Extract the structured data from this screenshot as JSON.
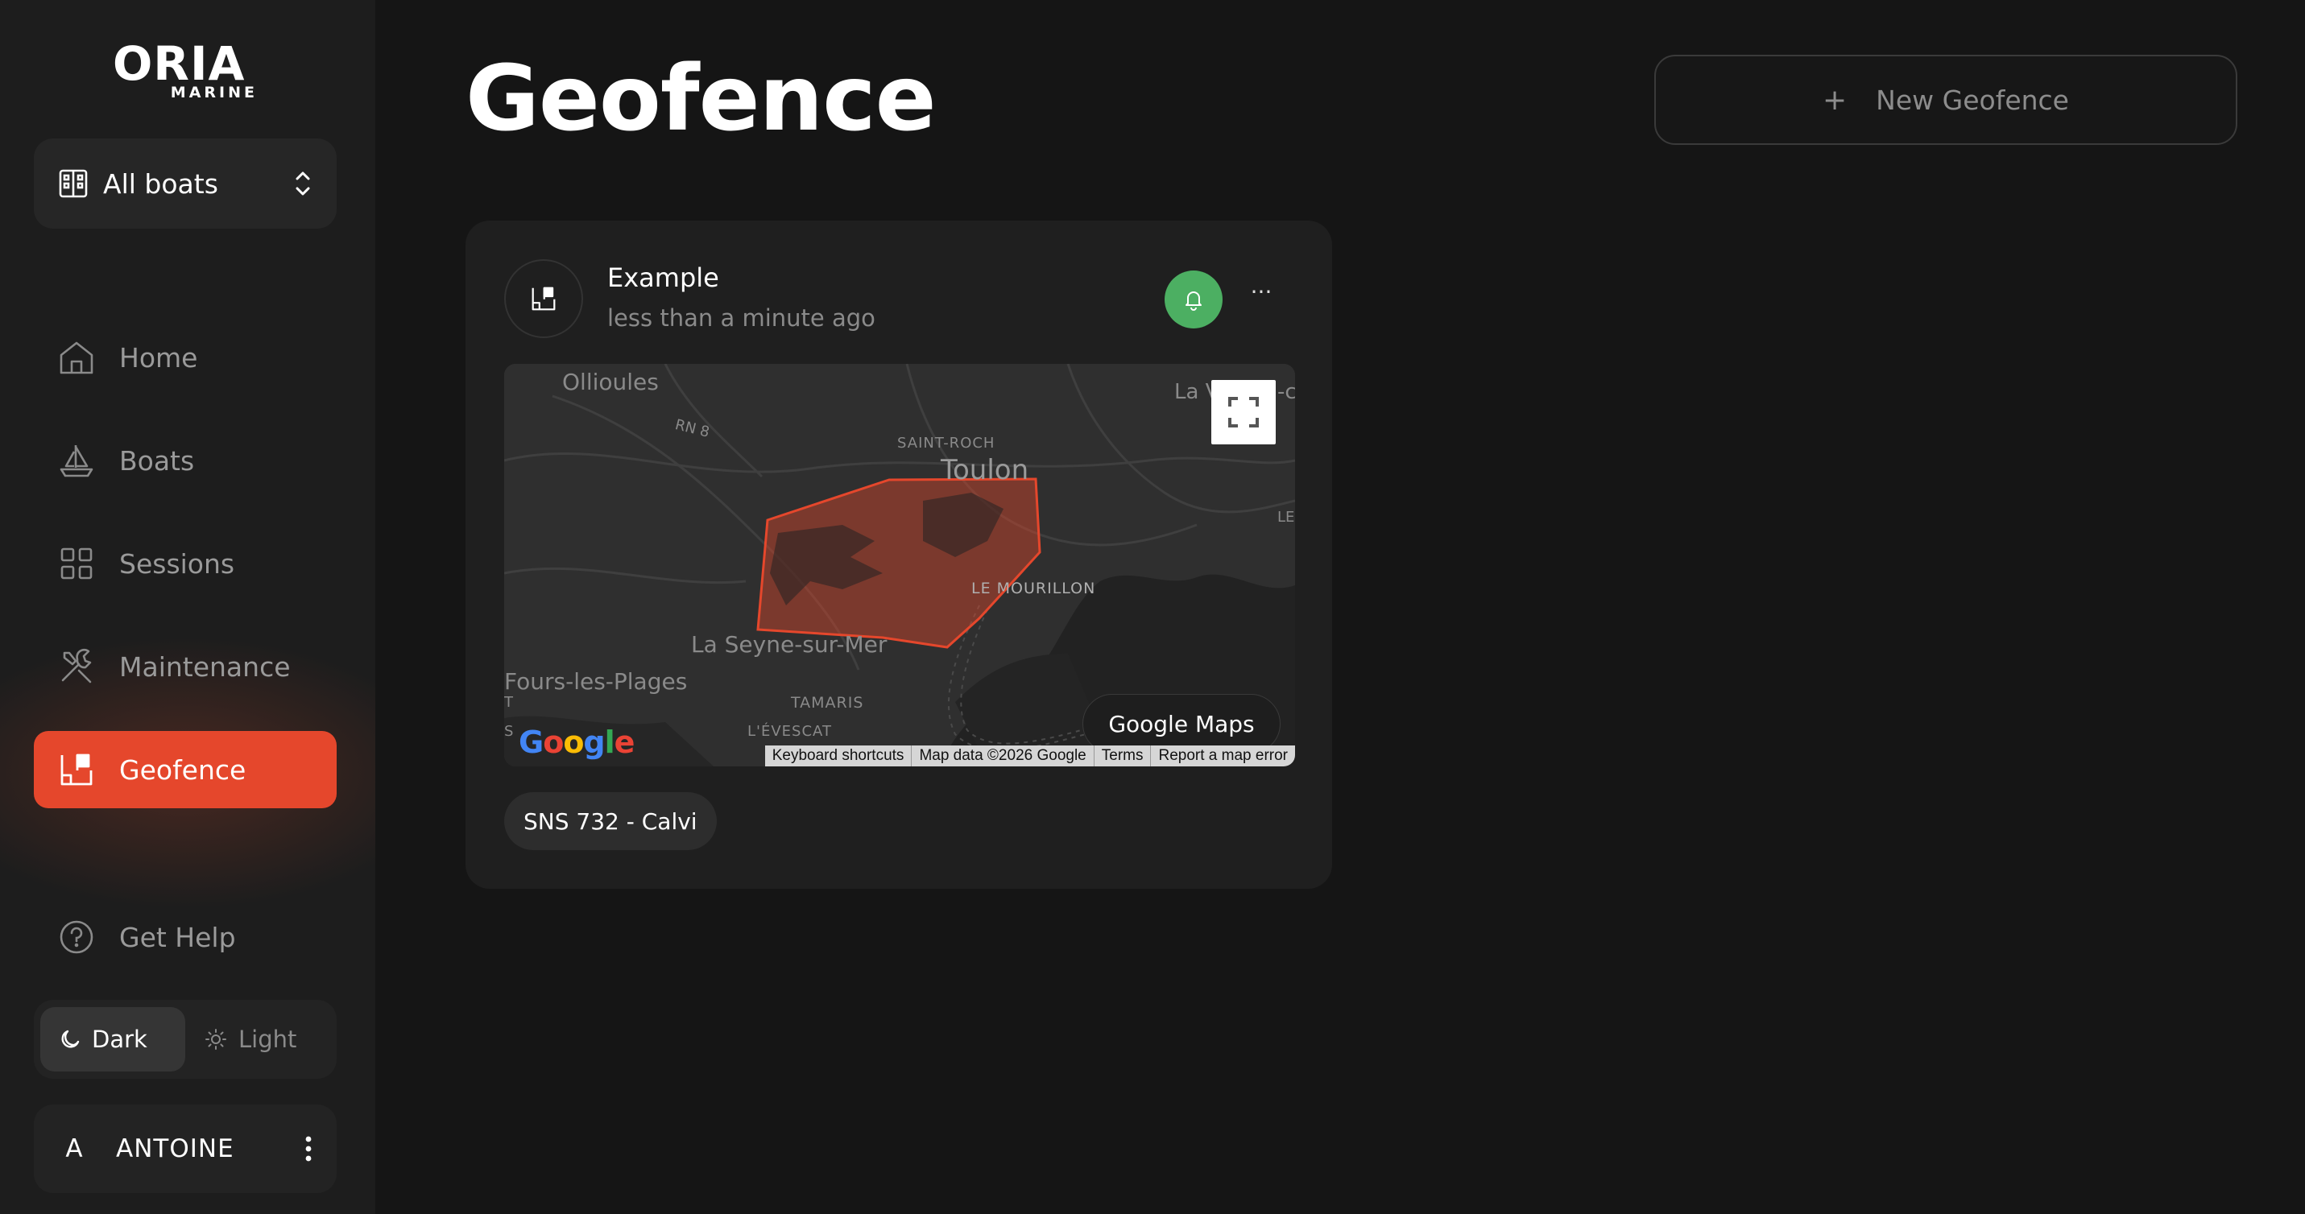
{
  "brand": {
    "name": "ORIA",
    "sub": "MARINE"
  },
  "boat_selector": {
    "label": "All boats",
    "icon": "building-icon"
  },
  "nav": {
    "home": "Home",
    "boats": "Boats",
    "sessions": "Sessions",
    "maintenance": "Maintenance",
    "geofence": "Geofence",
    "active": "Geofence"
  },
  "help": {
    "label": "Get Help"
  },
  "theme": {
    "dark": "Dark",
    "light": "Light",
    "selected": "Dark"
  },
  "user": {
    "initial": "A",
    "name": "ANTOINE"
  },
  "page": {
    "title": "Geofence"
  },
  "new_button": {
    "label": "New Geofence"
  },
  "card": {
    "title": "Example",
    "time": "less than a minute ago",
    "alerts_enabled": true,
    "more_label": "···",
    "boat_tag": "SNS 732 - Calvi"
  },
  "map": {
    "labels": {
      "ollioules": "Ollioules",
      "rn8": "RN 8",
      "saint_roch": "SAINT-ROCH",
      "toulon": "Toulon",
      "la_v": "La V",
      "le_mourillon": "LE MOURILLON",
      "la_seyne": "La Seyne-sur-Mer",
      "fours": "Fours-les-Plages",
      "tamaris": "TAMARIS",
      "levescat": "L'ÉVESCAT",
      "le": "LE",
      "t": "T",
      "s": "S",
      "c": "-c"
    },
    "google_maps_button": "Google Maps",
    "google_logo": "Google",
    "attribution": {
      "shortcuts": "Keyboard shortcuts",
      "data": "Map data ©2026 Google",
      "terms": "Terms",
      "report": "Report a map error"
    },
    "geofence_color": "#e5472c"
  },
  "colors": {
    "accent": "#e5472c",
    "success": "#4caf62",
    "background": "#151515",
    "sidebar": "#1d1d1d"
  }
}
